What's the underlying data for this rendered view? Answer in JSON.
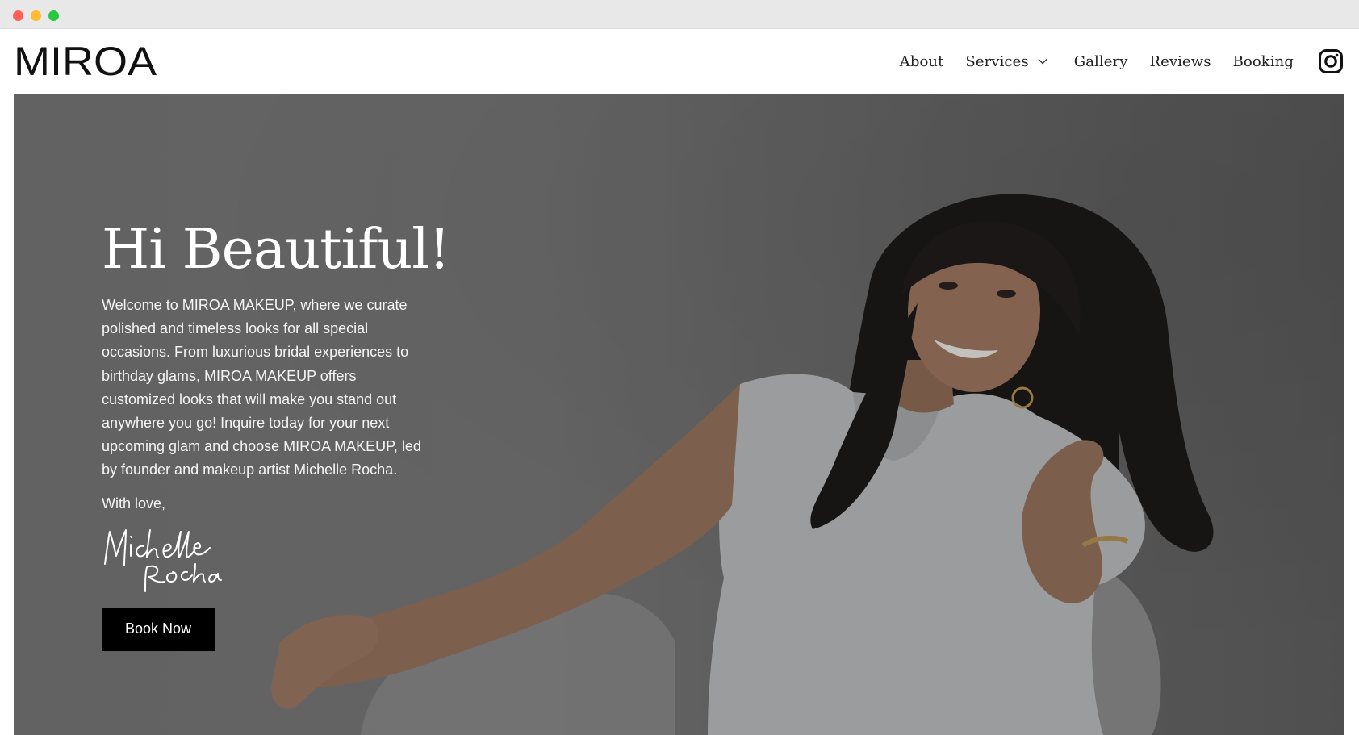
{
  "window": {
    "controls": [
      "close",
      "minimize",
      "maximize"
    ]
  },
  "header": {
    "logo_text": "MIROA",
    "nav": {
      "about": "About",
      "services": "Services",
      "gallery": "Gallery",
      "reviews": "Reviews",
      "booking": "Booking"
    },
    "icons": {
      "services_dropdown": "chevron-down-icon",
      "social": "instagram-icon"
    }
  },
  "hero": {
    "title": "Hi Beautiful!",
    "body": "Welcome to MIROA MAKEUP, where we curate polished and timeless looks for all special occasions. From luxurious bridal experiences to birthday glams, MIROA MAKEUP offers customized looks that will make you stand out anywhere you go! Inquire today for your next upcoming glam and choose MIROA MAKEUP, led by founder and makeup artist Michelle Rocha.",
    "signoff": "With love,",
    "signature_text": "Michelle Rocha",
    "cta_label": "Book Now"
  },
  "colors": {
    "text_dark": "#222222",
    "hero_overlay": "#6f6f6f",
    "button_bg": "#000000",
    "button_text": "#ffffff",
    "dot_red": "#ff5f57",
    "dot_yellow": "#febc2e",
    "dot_green": "#28c840"
  }
}
